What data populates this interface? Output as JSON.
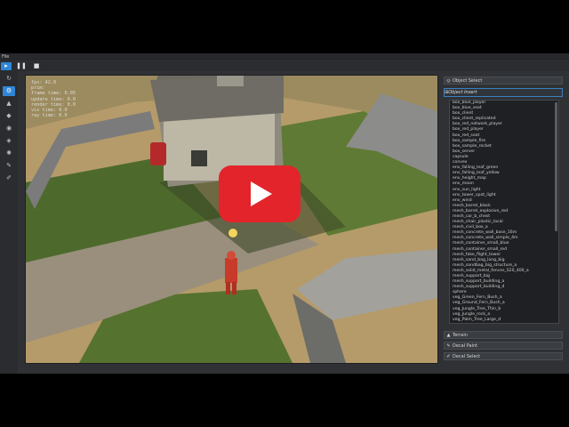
{
  "menu": {
    "file": "File"
  },
  "toolbar": {
    "select": "▸",
    "pause": "❚❚",
    "stop": "■"
  },
  "sidebar": {
    "icons": [
      "rotate-icon",
      "object-icon",
      "terrain-icon",
      "paint-icon",
      "light-icon",
      "tag-icon",
      "settings-icon",
      "brush-icon",
      "edit-icon"
    ]
  },
  "debug": {
    "lines": [
      "fps: 42.0",
      "prim: ",
      "frame time: 0.05",
      "update time: 0.0",
      "render time: 0.0",
      "vis time: 0.0",
      "ray time: 0.0"
    ]
  },
  "panel": {
    "object_select": "Object Select",
    "object_insert": "Object Insert",
    "terrain": "Terrain",
    "decal_paint": "Decal Paint",
    "decal_select": "Decal Select",
    "items": [
      "box_blue_player",
      "box_blue_seat",
      "box_client",
      "box_client_replicated",
      "box_red_network_player",
      "box_red_player",
      "box_red_seat",
      "box_sample_fire",
      "box_sample_rocket",
      "box_server",
      "capsule",
      "convex",
      "env_falling_leaf_green",
      "env_falling_leaf_yellow",
      "env_height_map",
      "env_moon",
      "env_sun_light",
      "env_tower_spot_light",
      "env_wind",
      "mesh_barrel_black",
      "mesh_barrel_explosive_red",
      "mesh_car_b_chest",
      "mesh_chair_plastic_local",
      "mesh_civil_box_a",
      "mesh_concrete_wall_base_16m",
      "mesh_concrete_wall_simple_4m",
      "mesh_container_small_blue",
      "mesh_container_small_red",
      "mesh_fake_flight_tower",
      "mesh_sand_bag_long_big",
      "mesh_sandbag_big_structure_a",
      "mesh_solid_metal_fences_S20_400_a",
      "mesh_support_big",
      "mesh_support_building_a",
      "mesh_support_building_d",
      "sphere",
      "veg_Green_Fern_Bush_a",
      "veg_Ground_Fern_Bush_a",
      "veg_Jungle_Tree_Thin_b",
      "veg_Jungle_rock_a",
      "veg_Palm_Tree_Large_d"
    ]
  }
}
